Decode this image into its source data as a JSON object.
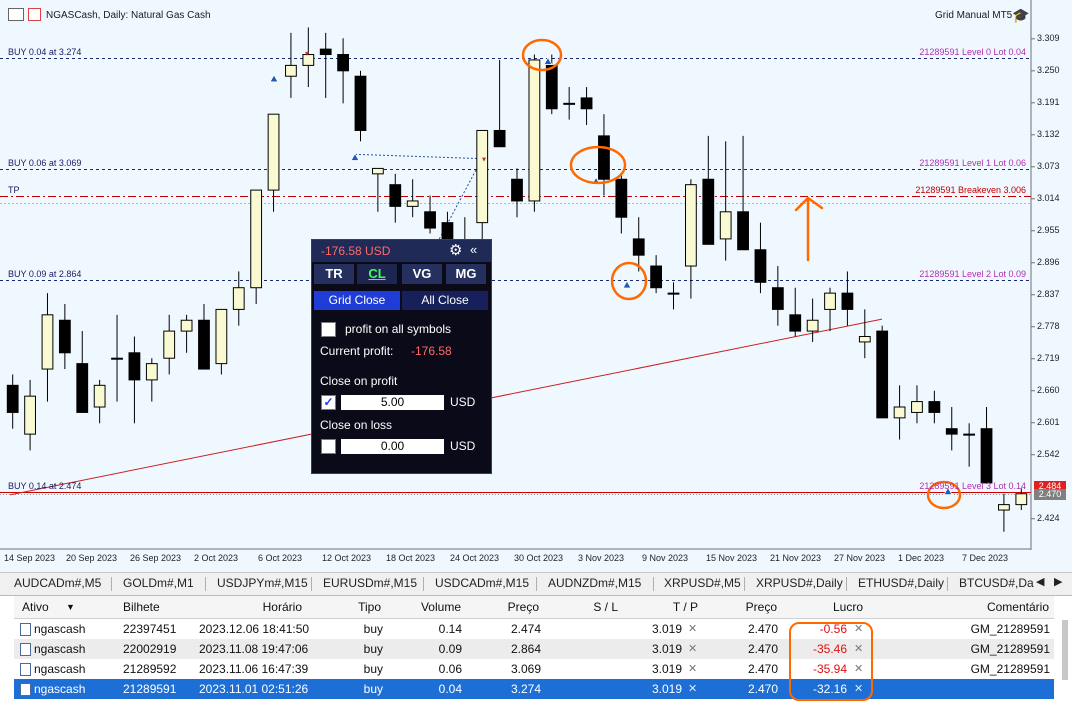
{
  "window": {
    "symbol_title": "NGASCash, Daily: Natural Gas Cash",
    "ea_name": "Grid Manual MT5"
  },
  "chart_data": {
    "type": "candlestick",
    "y_ticks": [
      "3.309",
      "3.250",
      "3.191",
      "3.132",
      "3.073",
      "3.014",
      "2.955",
      "2.896",
      "2.837",
      "2.778",
      "2.719",
      "2.660",
      "2.601",
      "2.542",
      "2.424"
    ],
    "x_ticks": [
      "14 Sep 2023",
      "20 Sep 2023",
      "26 Sep 2023",
      "2 Oct 2023",
      "6 Oct 2023",
      "12 Oct 2023",
      "18 Oct 2023",
      "24 Oct 2023",
      "30 Oct 2023",
      "3 Nov 2023",
      "9 Nov 2023",
      "15 Nov 2023",
      "21 Nov 2023",
      "27 Nov 2023",
      "1 Dec 2023",
      "7 Dec 2023"
    ],
    "ylim": [
      2.37,
      3.34
    ],
    "candles": [
      [
        2.67,
        2.69,
        2.59,
        2.62
      ],
      [
        2.58,
        2.68,
        2.55,
        2.65
      ],
      [
        2.7,
        2.84,
        2.64,
        2.8
      ],
      [
        2.79,
        2.82,
        2.7,
        2.73
      ],
      [
        2.71,
        2.77,
        2.64,
        2.62
      ],
      [
        2.63,
        2.68,
        2.6,
        2.67
      ],
      [
        2.72,
        2.8,
        2.64,
        2.72
      ],
      [
        2.73,
        2.76,
        2.6,
        2.68
      ],
      [
        2.68,
        2.72,
        2.64,
        2.71
      ],
      [
        2.72,
        2.8,
        2.69,
        2.77
      ],
      [
        2.77,
        2.8,
        2.73,
        2.79
      ],
      [
        2.79,
        2.82,
        2.72,
        2.7
      ],
      [
        2.71,
        2.8,
        2.69,
        2.81
      ],
      [
        2.81,
        2.88,
        2.78,
        2.85
      ],
      [
        2.85,
        3.03,
        2.82,
        3.03
      ],
      [
        3.03,
        3.17,
        2.99,
        3.17
      ],
      [
        3.24,
        3.32,
        3.2,
        3.26
      ],
      [
        3.26,
        3.33,
        3.22,
        3.28
      ],
      [
        3.29,
        3.32,
        3.2,
        3.28
      ],
      [
        3.28,
        3.31,
        3.19,
        3.25
      ],
      [
        3.24,
        3.25,
        3.12,
        3.14
      ],
      [
        3.06,
        3.07,
        2.99,
        3.07
      ],
      [
        3.04,
        3.06,
        2.97,
        3.0
      ],
      [
        3.0,
        3.05,
        2.98,
        3.01
      ],
      [
        2.99,
        3.02,
        2.95,
        2.96
      ],
      [
        2.97,
        2.99,
        2.93,
        2.89
      ],
      [
        2.93,
        2.98,
        2.9,
        2.91
      ],
      [
        2.97,
        3.05,
        2.93,
        3.14
      ],
      [
        3.14,
        3.27,
        3.12,
        3.11
      ],
      [
        3.05,
        3.07,
        2.98,
        3.01
      ],
      [
        3.01,
        3.28,
        2.99,
        3.27
      ],
      [
        3.26,
        3.28,
        3.17,
        3.18
      ],
      [
        3.19,
        3.22,
        3.16,
        3.19
      ],
      [
        3.2,
        3.22,
        3.15,
        3.18
      ],
      [
        3.13,
        3.17,
        3.02,
        3.05
      ],
      [
        3.05,
        3.06,
        2.95,
        2.98
      ],
      [
        2.94,
        2.98,
        2.88,
        2.91
      ],
      [
        2.89,
        2.91,
        2.84,
        2.85
      ],
      [
        2.84,
        2.86,
        2.81,
        2.84
      ],
      [
        2.89,
        3.05,
        2.83,
        3.04
      ],
      [
        3.05,
        3.13,
        2.94,
        2.93
      ],
      [
        2.94,
        3.12,
        2.9,
        2.99
      ],
      [
        2.99,
        3.13,
        2.92,
        2.92
      ],
      [
        2.92,
        2.97,
        2.84,
        2.86
      ],
      [
        2.85,
        2.89,
        2.78,
        2.81
      ],
      [
        2.8,
        2.85,
        2.76,
        2.77
      ],
      [
        2.77,
        2.83,
        2.75,
        2.79
      ],
      [
        2.81,
        2.85,
        2.77,
        2.84
      ],
      [
        2.84,
        2.88,
        2.78,
        2.81
      ],
      [
        2.75,
        2.81,
        2.72,
        2.76
      ],
      [
        2.77,
        2.78,
        2.66,
        2.61
      ],
      [
        2.61,
        2.67,
        2.57,
        2.63
      ],
      [
        2.62,
        2.67,
        2.6,
        2.64
      ],
      [
        2.64,
        2.66,
        2.6,
        2.62
      ],
      [
        2.59,
        2.63,
        2.55,
        2.58
      ],
      [
        2.58,
        2.6,
        2.52,
        2.58
      ],
      [
        2.59,
        2.63,
        2.54,
        2.49
      ],
      [
        2.44,
        2.47,
        2.4,
        2.45
      ],
      [
        2.45,
        2.48,
        2.44,
        2.47
      ]
    ],
    "levels": [
      {
        "left": "BUY 0.04 at 3.274",
        "right": "21289591 Level 0 Lot 0.04",
        "value": 3.274,
        "color": "#1a2a70",
        "style": "dash"
      },
      {
        "left": "BUY 0.06 at 3.069",
        "right": "21289591 Level 1 Lot 0.06",
        "value": 3.069,
        "color": "#1a2a70",
        "style": "dash"
      },
      {
        "left": "TP",
        "right": "21289591 Breakeven 3.006",
        "value": 3.019,
        "color": "#c00000",
        "style": "dashdot"
      },
      {
        "left": "BUY 0.09 at 2.864",
        "right": "21289591 Level 2 Lot 0.09",
        "value": 2.864,
        "color": "#1a2a70",
        "style": "dash"
      },
      {
        "left": "BUY 0.14 at 2.474",
        "right": "21289591 Level 3 Lot 0.14",
        "value": 2.474,
        "color": "#cc0000",
        "style": "solid"
      }
    ],
    "price_boxes": [
      {
        "text": "2.484",
        "color": "#e02020"
      },
      {
        "text": "2.470",
        "color": "#808080"
      }
    ]
  },
  "panel": {
    "profit_text": "-176.58 USD",
    "tabs": [
      "TR",
      "CL",
      "VG",
      "MG"
    ],
    "active_tab": "CL",
    "grid_close": "Grid Close",
    "all_close": "All Close",
    "profit_all_label": "profit on all symbols",
    "current_profit_label": "Current profit:",
    "current_profit_value": "-176.58",
    "close_on_profit_label": "Close on profit",
    "close_on_profit_value": "5.00",
    "close_on_profit_checked": true,
    "close_on_loss_label": "Close on loss",
    "close_on_loss_value": "0.00",
    "currency": "USD"
  },
  "symbol_tabs": [
    "AUDCADm#,M5",
    "GOLDm#,M1",
    "USDJPYm#,M15",
    "EURUSDm#,M15",
    "USDCADm#,M15",
    "AUDNZDm#,M15",
    "XRPUSD#,M5",
    "XRPUSD#,Daily",
    "ETHUSD#,Daily",
    "BTCUSD#,Da"
  ],
  "table": {
    "headers": {
      "ativo": "Ativo",
      "bilhete": "Bilhete",
      "horario": "Horário",
      "tipo": "Tipo",
      "volume": "Volume",
      "preco": "Preço",
      "sl": "S / L",
      "tp": "T / P",
      "preco2": "Preço",
      "lucro": "Lucro",
      "comentario": "Comentário"
    },
    "rows": [
      {
        "ativo": "ngascash",
        "bilhete": "22397451",
        "horario": "2023.12.06 18:41:50",
        "tipo": "buy",
        "volume": "0.14",
        "preco": "2.474",
        "tp": "3.019",
        "preco2": "2.470",
        "lucro": "-0.56",
        "comentario": "GM_21289591"
      },
      {
        "ativo": "ngascash",
        "bilhete": "22002919",
        "horario": "2023.11.08 19:47:06",
        "tipo": "buy",
        "volume": "0.09",
        "preco": "2.864",
        "tp": "3.019",
        "preco2": "2.470",
        "lucro": "-35.46",
        "comentario": "GM_21289591"
      },
      {
        "ativo": "ngascash",
        "bilhete": "21289592",
        "horario": "2023.11.06 16:47:39",
        "tipo": "buy",
        "volume": "0.06",
        "preco": "3.069",
        "tp": "3.019",
        "preco2": "2.470",
        "lucro": "-35.94",
        "comentario": "GM_21289591"
      },
      {
        "ativo": "ngascash",
        "bilhete": "21289591",
        "horario": "2023.11.01 02:51:26",
        "tipo": "buy",
        "volume": "0.04",
        "preco": "3.274",
        "tp": "3.019",
        "preco2": "2.470",
        "lucro": "-32.16",
        "comentario": ""
      }
    ]
  },
  "colors": {
    "accent": "#1d6fd6",
    "loss": "#e01010",
    "annotation": "#ff6a00"
  }
}
